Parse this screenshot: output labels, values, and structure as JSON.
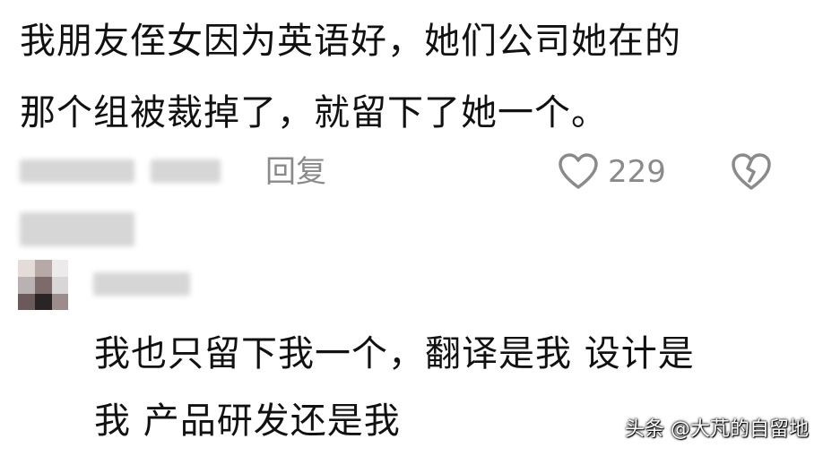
{
  "comment": {
    "text_line1": "我朋友侄女因为英语好，她们公司她在的",
    "text_line2": "那个组被裁掉了，就留下了她一个。",
    "reply_label": "回复",
    "like_count": "229",
    "like_icon": "heart-outline-icon",
    "dislike_icon": "broken-heart-icon"
  },
  "reply": {
    "text_line1": "我也只留下我一个，翻译是我 设计是",
    "text_line2": "我 产品研发还是我"
  },
  "watermark": {
    "text": "头条 @大芃的自留地"
  },
  "colors": {
    "text": "#111111",
    "meta": "#8a8a8a",
    "blur": "#d6d6d6"
  }
}
